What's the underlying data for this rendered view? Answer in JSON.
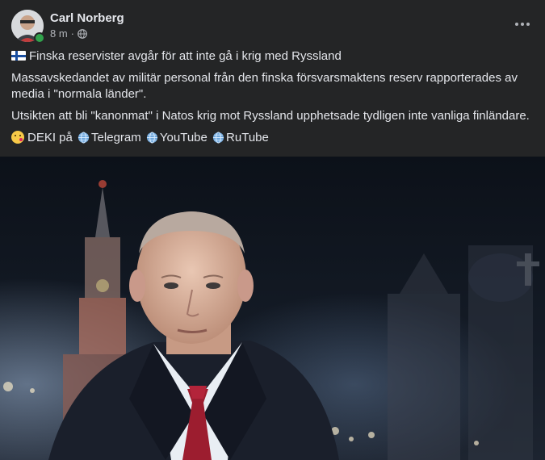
{
  "post": {
    "author": "Carl Norberg",
    "time": "8 m",
    "separator": "·",
    "visibility_icon": "globe-icon",
    "more_icon": "more-dots-icon",
    "headline": "Finska reservister avgår för att inte gå i krig med Ryssland",
    "paragraph1": "Massavskedandet av militär personal från den finska försvarsmaktens reserv rapporterades av media i \"normala länder\".",
    "paragraph2": "Utsikten att bli \"kanonmat\" i Natos krig mot Ryssland upphetsade tydligen inte vanliga finländare.",
    "footer": {
      "prefix": "DEKI på",
      "link1": "Telegram",
      "link2": "YouTube",
      "link3": "RuTube"
    }
  },
  "colors": {
    "card_bg": "#242526",
    "text_primary": "#e4e6eb",
    "text_secondary": "#b0b3b8",
    "online": "#31a24c"
  }
}
